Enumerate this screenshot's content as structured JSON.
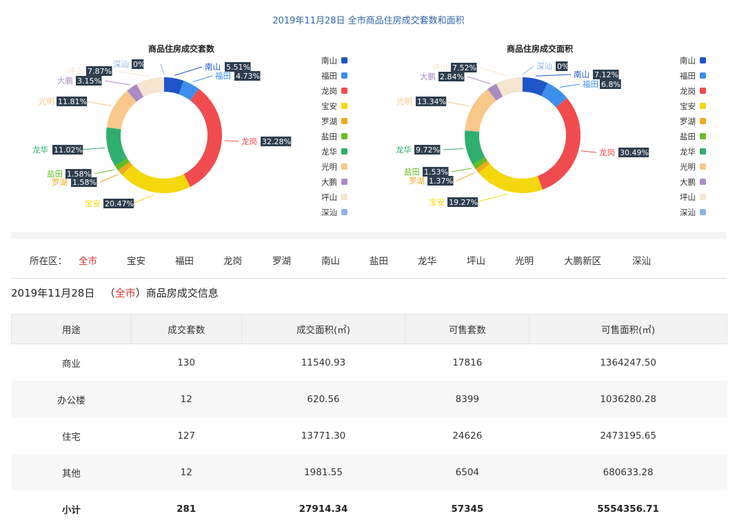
{
  "page_title": "2019年11月28日 全市商品住房成交套数和面积",
  "charts": [
    {
      "title": "商品住房成交套数",
      "slices": [
        {
          "name": "南山",
          "value": 5.51,
          "pct": "5.51%",
          "color": "#1e55c8"
        },
        {
          "name": "福田",
          "value": 4.73,
          "pct": "4.73%",
          "color": "#3d8fec"
        },
        {
          "name": "龙岗",
          "value": 32.28,
          "pct": "32.28%",
          "color": "#f04c4f"
        },
        {
          "name": "宝安",
          "value": 20.47,
          "pct": "20.47%",
          "color": "#f4d70c"
        },
        {
          "name": "罗湖",
          "value": 1.58,
          "pct": "1.58%",
          "color": "#eea91e"
        },
        {
          "name": "盐田",
          "value": 1.58,
          "pct": "1.58%",
          "color": "#67bc23"
        },
        {
          "name": "龙华",
          "value": 11.02,
          "pct": "11.02%",
          "color": "#2fae6c"
        },
        {
          "name": "光明",
          "value": 11.81,
          "pct": "11.81%",
          "color": "#f8c88a"
        },
        {
          "name": "大鹏",
          "value": 3.15,
          "pct": "3.15%",
          "color": "#a98bc5"
        },
        {
          "name": "坪山",
          "value": 7.87,
          "pct": "7.87%",
          "color": "#f6e5cf"
        },
        {
          "name": "深汕",
          "value": 0,
          "pct": "0%",
          "color": "#8eb2e6"
        }
      ]
    },
    {
      "title": "商品住房成交面积",
      "slices": [
        {
          "name": "南山",
          "value": 7.12,
          "pct": "7.12%",
          "color": "#1e55c8"
        },
        {
          "name": "福田",
          "value": 6.8,
          "pct": "6.8%",
          "color": "#3d8fec"
        },
        {
          "name": "龙岗",
          "value": 30.49,
          "pct": "30.49%",
          "color": "#f04c4f"
        },
        {
          "name": "宝安",
          "value": 19.27,
          "pct": "19.27%",
          "color": "#f4d70c"
        },
        {
          "name": "罗湖",
          "value": 1.37,
          "pct": "1.37%",
          "color": "#eea91e"
        },
        {
          "name": "盐田",
          "value": 1.53,
          "pct": "1.53%",
          "color": "#67bc23"
        },
        {
          "name": "龙华",
          "value": 9.72,
          "pct": "9.72%",
          "color": "#2fae6c"
        },
        {
          "name": "光明",
          "value": 13.34,
          "pct": "13.34%",
          "color": "#f8c88a"
        },
        {
          "name": "大鹏",
          "value": 2.84,
          "pct": "2.84%",
          "color": "#a98bc5"
        },
        {
          "name": "坪山",
          "value": 7.52,
          "pct": "7.52%",
          "color": "#f6e5cf"
        },
        {
          "name": "深汕",
          "value": 0,
          "pct": "0%",
          "color": "#8eb2e6"
        }
      ]
    }
  ],
  "chart_data": [
    {
      "type": "pie",
      "title": "商品住房成交套数",
      "categories": [
        "南山",
        "福田",
        "龙岗",
        "宝安",
        "罗湖",
        "盐田",
        "龙华",
        "光明",
        "大鹏",
        "坪山",
        "深汕"
      ],
      "values": [
        5.51,
        4.73,
        32.28,
        20.47,
        1.58,
        1.58,
        11.02,
        11.81,
        3.15,
        7.87,
        0
      ],
      "legend": "right"
    },
    {
      "type": "pie",
      "title": "商品住房成交面积",
      "categories": [
        "南山",
        "福田",
        "龙岗",
        "宝安",
        "罗湖",
        "盐田",
        "龙华",
        "光明",
        "大鹏",
        "坪山",
        "深汕"
      ],
      "values": [
        7.12,
        6.8,
        30.49,
        19.27,
        1.37,
        1.53,
        9.72,
        13.34,
        2.84,
        7.52,
        0
      ],
      "legend": "right"
    }
  ],
  "district_filter": {
    "label": "所在区：",
    "items": [
      "全市",
      "宝安",
      "福田",
      "龙岗",
      "罗湖",
      "南山",
      "盐田",
      "龙华",
      "坪山",
      "光明",
      "大鹏新区",
      "深汕"
    ],
    "active": "全市"
  },
  "info": {
    "date": "2019年11月28日",
    "open_paren": "（",
    "area": "全市",
    "close_paren": "）",
    "suffix": "商品房成交信息"
  },
  "table": {
    "headers": [
      "用途",
      "成交套数",
      "成交面积(㎡)",
      "可售套数",
      "可售面积(㎡)"
    ],
    "rows": [
      [
        "商业",
        "130",
        "11540.93",
        "17816",
        "1364247.50"
      ],
      [
        "办公楼",
        "12",
        "620.56",
        "8399",
        "1036280.28"
      ],
      [
        "住宅",
        "127",
        "13771.30",
        "24626",
        "2473195.65"
      ],
      [
        "其他",
        "12",
        "1981.55",
        "6504",
        "680633.28"
      ],
      [
        "小计",
        "281",
        "27914.34",
        "57345",
        "5554356.71"
      ]
    ]
  }
}
